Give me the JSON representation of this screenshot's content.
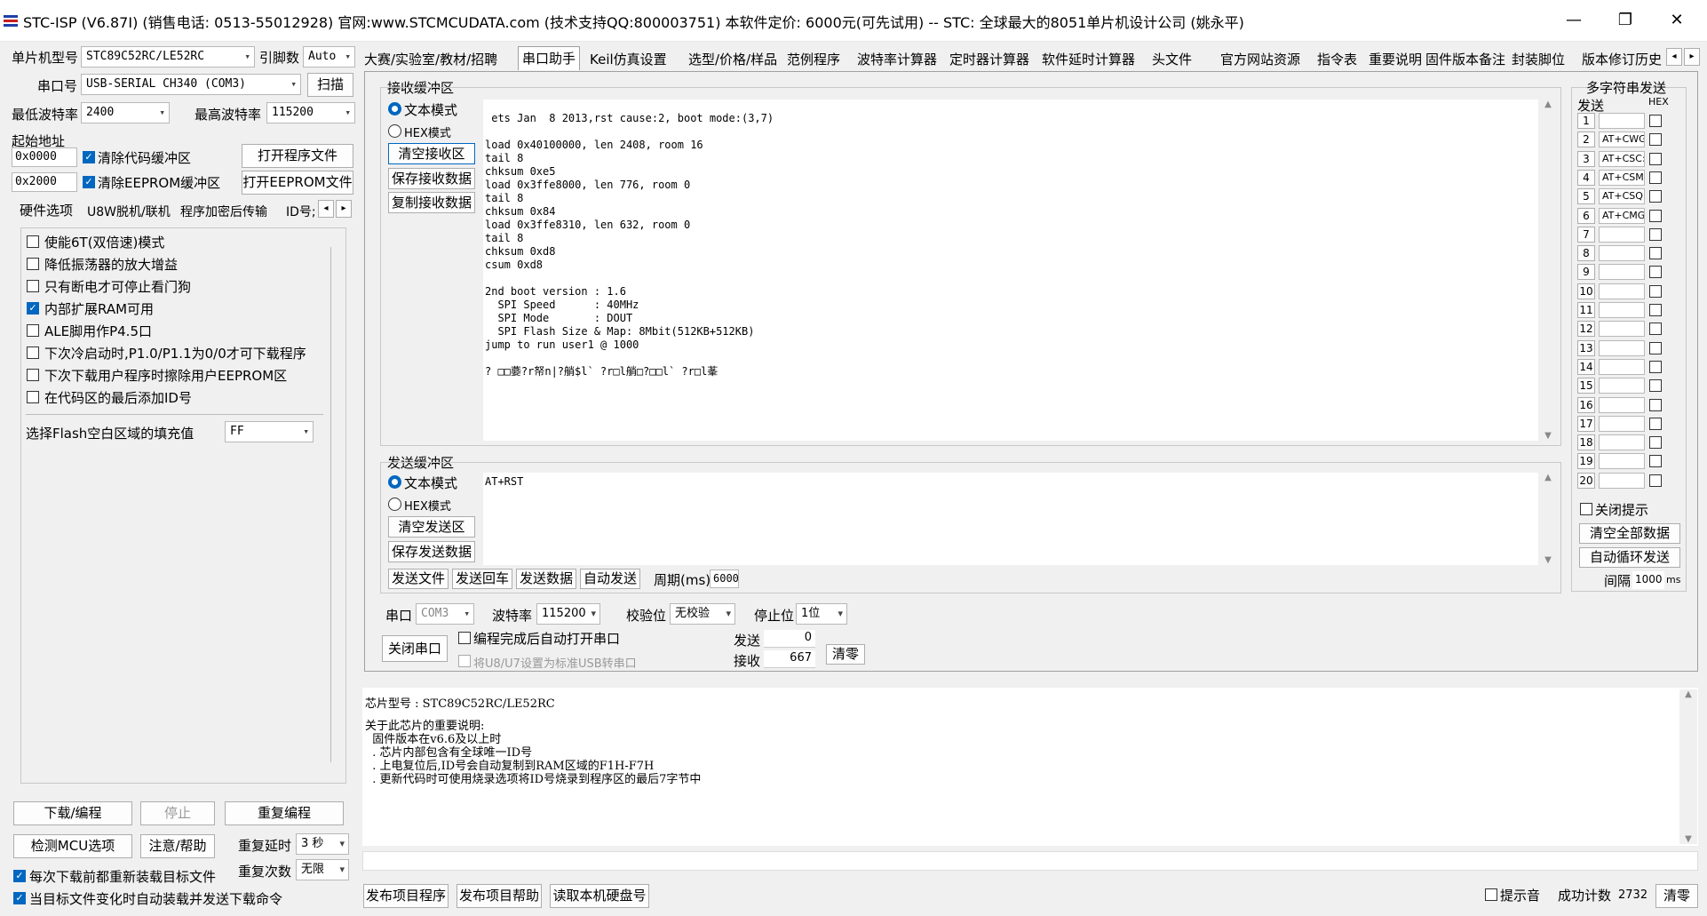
{
  "window": {
    "title": "STC-ISP (V6.87I) (销售电话: 0513-55012928) 官网:www.STCMCUDATA.com  (技术支持QQ:800003751) 本软件定价: 6000元(可先试用) -- STC: 全球最大的8051单片机设计公司 (姚永平)",
    "min": "—",
    "max": "❐",
    "close": "✕"
  },
  "left": {
    "mcu_label": "单片机型号",
    "mcu_value": "STC89C52RC/LE52RC",
    "pin_label": "引脚数",
    "pin_value": "Auto",
    "port_label": "串口号",
    "port_value": "USB-SERIAL CH340 (COM3)",
    "scan": "扫描",
    "min_baud_label": "最低波特率",
    "min_baud": "2400",
    "max_baud_label": "最高波特率",
    "max_baud": "115200",
    "start_addr_label": "起始地址",
    "addr1": "0x0000",
    "clear_code": "清除代码缓冲区",
    "open_prog": "打开程序文件",
    "addr2": "0x2000",
    "clear_eeprom": "清除EEPROM缓冲区",
    "open_eeprom": "打开EEPROM文件",
    "tabs": [
      "硬件选项",
      "U8W脱机/联机",
      "程序加密后传输",
      "ID号;"
    ],
    "options": [
      {
        "label": "使能6T(双倍速)模式",
        "checked": false
      },
      {
        "label": "降低振荡器的放大增益",
        "checked": false
      },
      {
        "label": "只有断电才可停止看门狗",
        "checked": false
      },
      {
        "label": "内部扩展RAM可用",
        "checked": true
      },
      {
        "label": "ALE脚用作P4.5口",
        "checked": false
      },
      {
        "label": "下次冷启动时,P1.0/P1.1为0/0才可下载程序",
        "checked": false
      },
      {
        "label": "下次下载用户程序时擦除用户EEPROM区",
        "checked": false
      },
      {
        "label": "在代码区的最后添加ID号",
        "checked": false
      }
    ],
    "fill_label": "选择Flash空白区域的填充值",
    "fill_value": "FF",
    "download": "下载/编程",
    "stop": "停止",
    "reprogram": "重复编程",
    "detect": "检测MCU选项",
    "help": "注意/帮助",
    "delay_label": "重复延时",
    "delay_value": "3 秒",
    "count_label": "重复次数",
    "count_value": "无限",
    "reload": "每次下载前都重新装载目标文件",
    "auto_load": "当目标文件变化时自动装载并发送下载命令"
  },
  "main_tabs": [
    "大赛/实验室/教材/招聘",
    "串口助手",
    "Keil仿真设置",
    "选型/价格/样品",
    "范例程序",
    "波特率计算器",
    "定时器计算器",
    "软件延时计算器",
    "头文件",
    "官方网站资源",
    "指令表",
    "重要说明",
    "固件版本备注",
    "封装脚位",
    "版本修订历史"
  ],
  "recv": {
    "title": "接收缓冲区",
    "text_mode": "文本模式",
    "hex_mode": "HEX模式",
    "clear": "清空接收区",
    "save": "保存接收数据",
    "copy": "复制接收数据",
    "content": " ets Jan  8 2013,rst cause:2, boot mode:(3,7)\n\nload 0x40100000, len 2408, room 16\ntail 8\nchksum 0xe5\nload 0x3ffe8000, len 776, room 0\ntail 8\nchksum 0x84\nload 0x3ffe8310, len 632, room 0\ntail 8\nchksum 0xd8\ncsum 0xd8\n\n2nd boot version : 1.6\n  SPI Speed      : 40MHz\n  SPI Mode       : DOUT\n  SPI Flash Size & Map: 8Mbit(512KB+512KB)\njump to run user1 @ 1000\n\n? □□嬊?r帑n|?艄$l` ?r□l艄□?□□l` ?r□l莑"
  },
  "send": {
    "title": "发送缓冲区",
    "text_mode": "文本模式",
    "hex_mode": "HEX模式",
    "clear": "清空发送区",
    "save": "保存发送数据",
    "content": "AT+RST",
    "send_file": "发送文件",
    "send_return": "发送回车",
    "send_data": "发送数据",
    "auto_send": "自动发送",
    "period_label": "周期(ms)",
    "period_value": "6000"
  },
  "serial": {
    "port_label": "串口",
    "port_value": "COM3",
    "baud_label": "波特率",
    "baud_value": "115200",
    "parity_label": "校验位",
    "parity_value": "无校验",
    "stop_label": "停止位",
    "stop_value": "1位",
    "close": "关闭串口",
    "auto_open": "编程完成后自动打开串口",
    "u8": "将U8/U7设置为标准USB转串口",
    "sent_label": "发送",
    "sent": "0",
    "recv_label": "接收",
    "recv": "667",
    "reset": "清零"
  },
  "multi": {
    "title": "多字符串发送",
    "send_col": "发送",
    "hex_col": "HEX",
    "rows": [
      {
        "n": "1",
        "v": ""
      },
      {
        "n": "2",
        "v": "AT+CWG"
      },
      {
        "n": "3",
        "v": "AT+CSC:"
      },
      {
        "n": "4",
        "v": "AT+CSM"
      },
      {
        "n": "5",
        "v": "AT+CSQ"
      },
      {
        "n": "6",
        "v": "AT+CMG"
      },
      {
        "n": "7",
        "v": ""
      },
      {
        "n": "8",
        "v": ""
      },
      {
        "n": "9",
        "v": ""
      },
      {
        "n": "10",
        "v": ""
      },
      {
        "n": "11",
        "v": ""
      },
      {
        "n": "12",
        "v": ""
      },
      {
        "n": "13",
        "v": ""
      },
      {
        "n": "14",
        "v": ""
      },
      {
        "n": "15",
        "v": ""
      },
      {
        "n": "16",
        "v": ""
      },
      {
        "n": "17",
        "v": ""
      },
      {
        "n": "18",
        "v": ""
      },
      {
        "n": "19",
        "v": ""
      },
      {
        "n": "20",
        "v": ""
      }
    ],
    "close_hint": "关闭提示",
    "clear_all": "清空全部数据",
    "auto_loop": "自动循环发送",
    "interval_label": "间隔",
    "interval": "1000",
    "interval_unit": "ms"
  },
  "info": {
    "chip": "芯片型号 : STC89C52RC/LE52RC",
    "lines": [
      "关于此芯片的重要说明:",
      "  固件版本在v6.6及以上时",
      "  . 芯片内部包含有全球唯一ID号",
      "  . 上电复位后,ID号会自动复制到RAM区域的F1H-F7H",
      "  . 更新代码时可使用烧录选项将ID号烧录到程序区的最后7字节中"
    ]
  },
  "bottom": {
    "publish": "发布项目程序",
    "publish_help": "发布项目帮助",
    "read_hdd": "读取本机硬盘号",
    "beep": "提示音",
    "success_label": "成功计数",
    "success": "2732",
    "clear": "清零"
  }
}
